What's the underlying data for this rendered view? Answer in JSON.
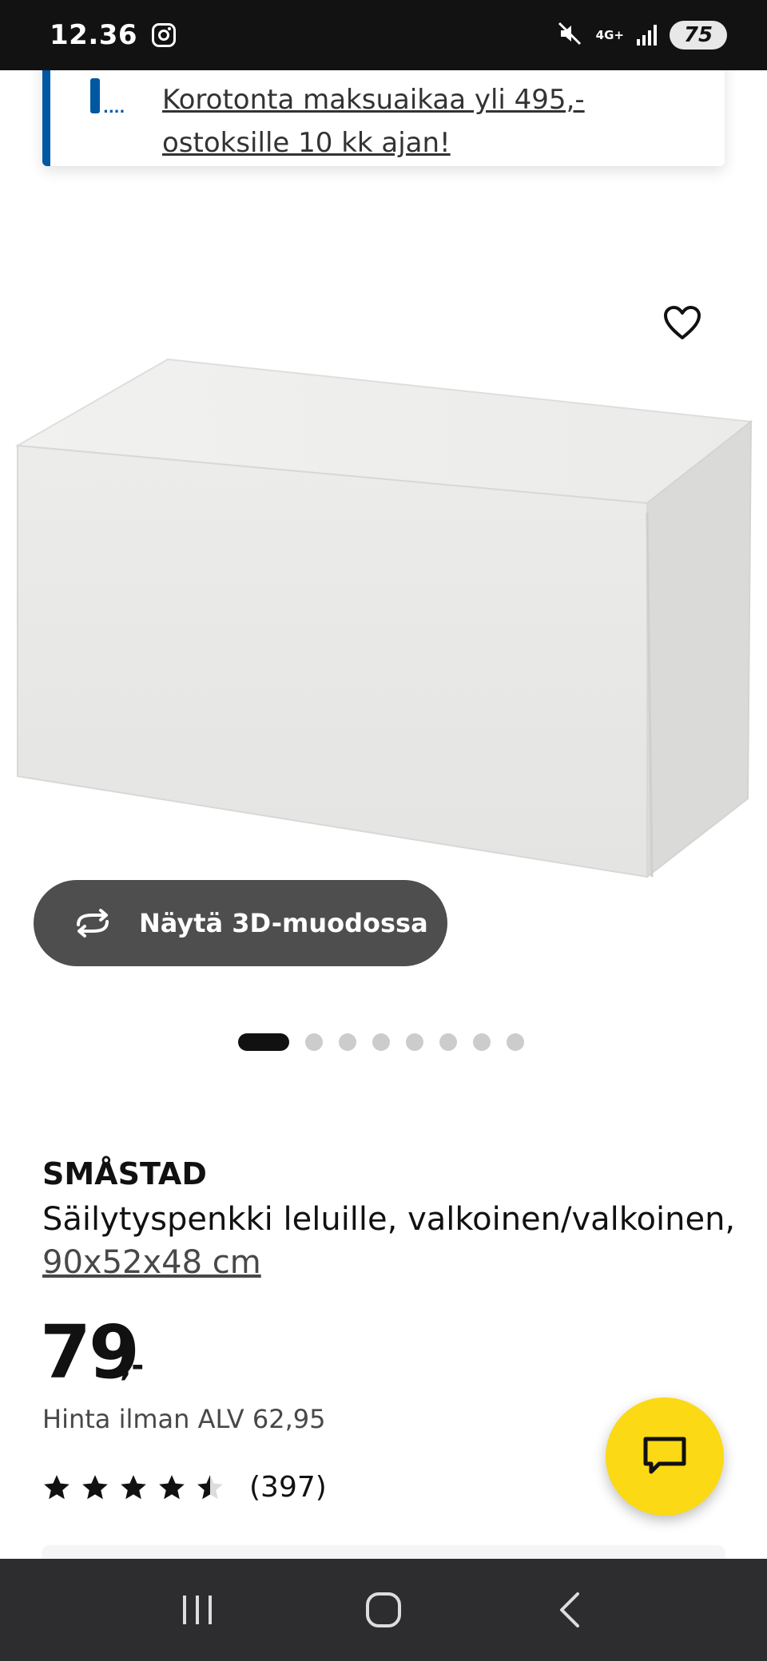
{
  "status_bar": {
    "time": "12.36",
    "network": "4G+",
    "battery": "75"
  },
  "promo": {
    "text_line1": "Korotonta maksuaikaa yli 495,-",
    "text_line2": "ostoksille 10 kk ajan!"
  },
  "product": {
    "view_3d_label": "Näytä 3D-muodossa",
    "carousel": {
      "count": 8,
      "active_index": 0
    },
    "name": "SMÅSTAD",
    "description": "Säilytyspenkki leluille, valkoinen/valkoinen,",
    "measurements": "90x52x48 cm",
    "price_whole": "79",
    "price_suffix": ",-",
    "price_without_vat": "Hinta ilman ALV 62,95",
    "rating_value": 4.5,
    "rating_max": 5,
    "review_count": "(397)"
  },
  "icons": {
    "favorite": "heart-outline-icon",
    "view_3d": "rotate-arrows-icon",
    "chat": "chat-bubble-icon",
    "nav_recents": "recents-icon",
    "nav_home": "home-icon",
    "nav_back": "back-icon"
  },
  "colors": {
    "brand_blue": "#0058a3",
    "chat_yellow": "#fbd914",
    "button_dark": "#4e4e4e"
  }
}
